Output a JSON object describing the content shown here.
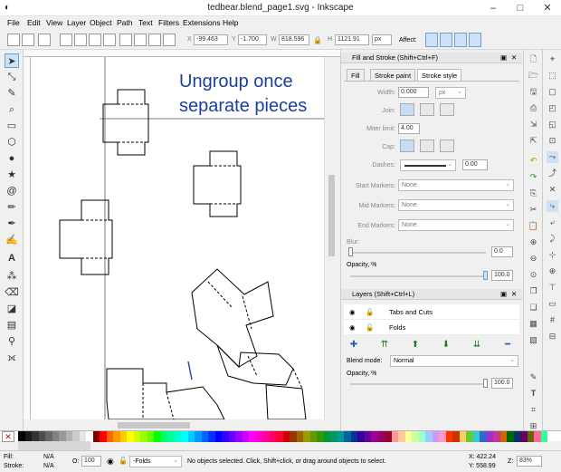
{
  "window": {
    "title": "tedbear.blend_page1.svg - Inkscape"
  },
  "menu": [
    "File",
    "Edit",
    "View",
    "Layer",
    "Object",
    "Path",
    "Text",
    "Filters",
    "Extensions",
    "Help"
  ],
  "toolbar": {
    "x_label": "X",
    "x_value": "-99.463",
    "y_label": "Y",
    "y_value": "-1.700",
    "w_label": "W",
    "w_value": "818.596",
    "h_label": "H",
    "h_value": "1121.91",
    "unit": "px",
    "affect_label": "Affect:"
  },
  "canvas": {
    "text_line1": "Ungroup once",
    "text_line2": "separate pieces"
  },
  "fill_stroke": {
    "panel_title": "Fill and Stroke (Shift+Ctrl+F)",
    "tabs": [
      "Fill",
      "Stroke paint",
      "Stroke style"
    ],
    "width_label": "Width:",
    "width_value": "0.000",
    "width_unit": "px",
    "join_label": "Join:",
    "miter_label": "Miter limit:",
    "miter_value": "4.00",
    "cap_label": "Cap:",
    "dashes_label": "Dashes:",
    "dashes_value": "0.00",
    "start_markers_label": "Start Markers:",
    "mid_markers_label": "Mid Markers:",
    "end_markers_label": "End Markers:",
    "markers_value": "None",
    "blur_label": "Blur:",
    "blur_value": "0.0",
    "opacity_label": "Opacity, %",
    "opacity_value": "100.0"
  },
  "layers": {
    "panel_title": "Layers (Shift+Ctrl+L)",
    "items": [
      "Tabs and Cuts",
      "Folds"
    ],
    "blend_label": "Blend mode:",
    "blend_value": "Normal",
    "opacity_label": "Opacity, %",
    "opacity_value": "100.0"
  },
  "status": {
    "fill_label": "Fill:",
    "fill_value": "N/A",
    "stroke_label": "Stroke:",
    "stroke_value": "N/A",
    "o_label": "O:",
    "o_value": "100",
    "layer_value": "-Folds",
    "message": "No objects selected. Click, Shift+click, or drag around objects to select.",
    "x_coord": "X: 422.24",
    "y_coord": "Y: 558.99",
    "z_label": "Z:",
    "zoom": "83%"
  },
  "palette_colors": [
    "#000000",
    "#1a1a1a",
    "#333333",
    "#4d4d4d",
    "#666666",
    "#808080",
    "#999999",
    "#b3b3b3",
    "#cccccc",
    "#e6e6e6",
    "#ffffff",
    "#800000",
    "#ff0000",
    "#ff6600",
    "#ff9900",
    "#ffcc00",
    "#ffff00",
    "#ccff00",
    "#99ff00",
    "#66ff00",
    "#00ff00",
    "#00ff66",
    "#00ff99",
    "#00ffcc",
    "#00ffff",
    "#00ccff",
    "#0099ff",
    "#0066ff",
    "#0033ff",
    "#0000ff",
    "#3300ff",
    "#6600ff",
    "#9900ff",
    "#cc00ff",
    "#ff00ff",
    "#ff00cc",
    "#ff0099",
    "#ff0066",
    "#ff0033",
    "#cc0000",
    "#993300",
    "#996600",
    "#999900",
    "#669900",
    "#339900",
    "#009933",
    "#009966",
    "#009999",
    "#006699",
    "#003399",
    "#330099",
    "#660099",
    "#990099",
    "#990066",
    "#990033",
    "#ff9999",
    "#ffcc99",
    "#ffff99",
    "#ccff99",
    "#99ffcc",
    "#99ccff",
    "#cc99ff",
    "#ff99cc",
    "#ff3300",
    "#cc3300",
    "#ffcc66",
    "#66cc33",
    "#33cccc",
    "#3366cc",
    "#9933cc",
    "#cc3399",
    "#cc6600",
    "#006600",
    "#003366",
    "#660066",
    "#666600",
    "#ff6699",
    "#33ff99"
  ]
}
